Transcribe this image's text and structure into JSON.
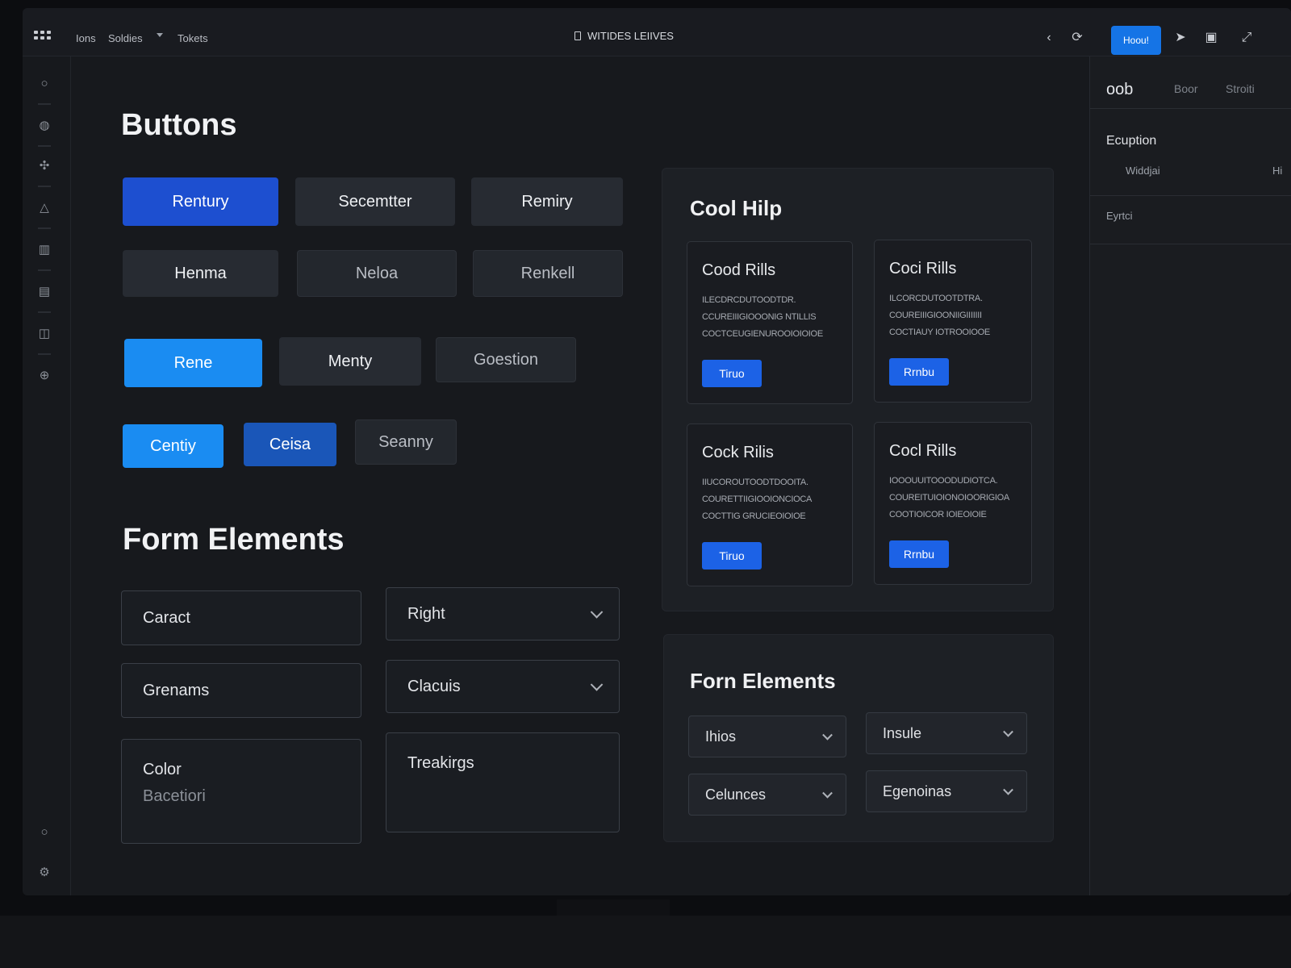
{
  "topbar": {
    "menu": [
      "Ions",
      "Soldies",
      "Tokets"
    ],
    "doc_title": "WITIDES LEIIVES",
    "action_label": "Hoou!"
  },
  "main": {
    "buttons_heading": "Buttons",
    "buttons": [
      {
        "label": "Rentury"
      },
      {
        "label": "Secemtter"
      },
      {
        "label": "Remiry"
      },
      {
        "label": "Henma"
      },
      {
        "label": "Neloa"
      },
      {
        "label": "Renkell"
      },
      {
        "label": "Rene"
      },
      {
        "label": "Menty"
      },
      {
        "label": "Goestion"
      },
      {
        "label": "Centiy"
      },
      {
        "label": "Ceisa"
      },
      {
        "label": "Seanny"
      }
    ],
    "form_heading": "Form Elements",
    "fields": [
      {
        "value": "Caract"
      },
      {
        "value": "Right"
      },
      {
        "value": "Grenams"
      },
      {
        "value": "Clacuis"
      },
      {
        "value": "Color",
        "placeholder": "Bacetiori"
      },
      {
        "value": "Treakirgs"
      }
    ]
  },
  "card_panel": {
    "title": "Cool Hilp",
    "cards": [
      {
        "title": "Cood Rills",
        "text": "ILECDRCDUTOODTDR. CCUREIIIGIOOONIG NTILLIS COCTCEUGIENUROOIOIOIOE",
        "button": "Tiruo"
      },
      {
        "title": "Coci Rills",
        "text": "ILCORCDUTOOTDTRA. COUREIIIGIOONIIGIIIIIII COCTIAUY IOTROOIOOE",
        "button": "Rrnbu"
      },
      {
        "title": "Cock Rilis",
        "text": "IIUCOROUTOODTDOOITA. COURETTIIGIOOIONCIOCA COCTTIG GRUCIEOIOIOE",
        "button": "Tiruo"
      },
      {
        "title": "Cocl Rills",
        "text": "IOOOUUITOOODUDIOTCA. COUREITUIOIONOIOORIGIOA COOTIOICOR IOIEOIOIE",
        "button": "Rrnbu"
      }
    ]
  },
  "form_panel": {
    "title": "Forn Elements",
    "fields": [
      "Ihios",
      "Insule",
      "Celunces",
      "Egenoinas"
    ]
  },
  "right_panel": {
    "tabs": [
      "oob",
      "Boor",
      "Stroiti"
    ],
    "section": "Ecuption",
    "row_label": "Widdjai",
    "row_value": "Hi",
    "item": "Eyrtci"
  },
  "colors": {
    "accent": "#1574e6",
    "primary_button": "#1d4fd0",
    "bright_button": "#1a8cf2"
  },
  "icons": [
    "apps-grid-icon",
    "chevron-left-icon",
    "refresh-icon",
    "share-icon",
    "save-icon",
    "expand-icon",
    "circle-icon",
    "globe-icon",
    "component-icon",
    "shapes-icon",
    "layout-icon",
    "window-icon",
    "book-icon",
    "plugin-icon",
    "help-icon",
    "settings-icon"
  ]
}
